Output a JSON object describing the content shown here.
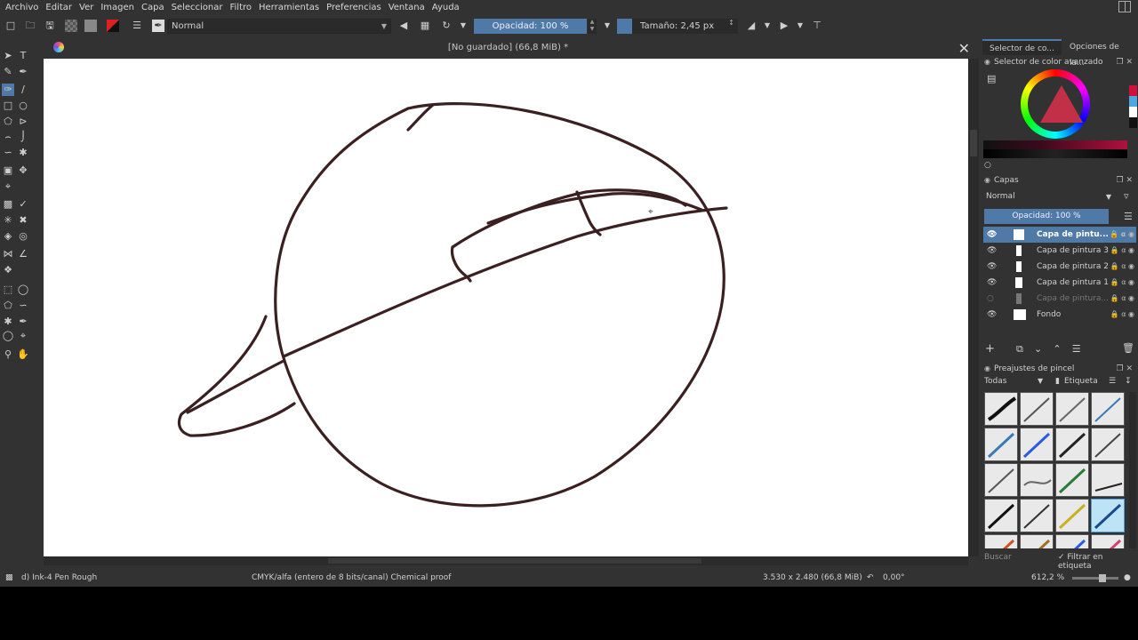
{
  "menu": [
    "Archivo",
    "Editar",
    "Ver",
    "Imagen",
    "Capa",
    "Seleccionar",
    "Filtro",
    "Herramientas",
    "Preferencias",
    "Ventana",
    "Ayuda"
  ],
  "toolbar": {
    "blend_mode": "Normal",
    "opacity_label": "Opacidad: 100 %",
    "size_label": "Tamaño: 2,45 px"
  },
  "document": {
    "title": "[No guardado]  (66,8 MiB) *",
    "close_glyph": "✕"
  },
  "dock": {
    "tabs": [
      "Selector de co...",
      "Opciones de la..."
    ],
    "color_panel_title": "Selector de color avanzado",
    "layers_panel_title": "Capas",
    "layers_blend": "Normal",
    "layers_opacity": "Opacidad:  100 %",
    "layers": [
      {
        "name": "Capa de pintu...",
        "selected": true,
        "visible": true
      },
      {
        "name": "Capa de pintura 3",
        "selected": false,
        "visible": true
      },
      {
        "name": "Capa de pintura 2",
        "selected": false,
        "visible": true
      },
      {
        "name": "Capa de pintura 1",
        "selected": false,
        "visible": true
      },
      {
        "name": "Capa de pintura...",
        "selected": false,
        "visible": false
      },
      {
        "name": "Fondo",
        "selected": false,
        "visible": true
      }
    ],
    "brush_panel_title": "Preajustes de pincel",
    "brush_filter_all": "Todas",
    "brush_filter_tag": "Etiqueta",
    "search_placeholder": "Buscar",
    "filter_in_tag": "Filtrar en etiqueta"
  },
  "status": {
    "brush_name": "d) Ink-4 Pen Rough",
    "color_profile": "CMYK/alfa (entero de 8 bits/canal)  Chemical proof",
    "image_size": "3.530 x 2.480 (66,8 MiB)",
    "rotation": "0,00°",
    "zoom": "612,2 %"
  },
  "colors": {
    "accent": "#4f7aa8",
    "stroke": "#3a2020"
  }
}
